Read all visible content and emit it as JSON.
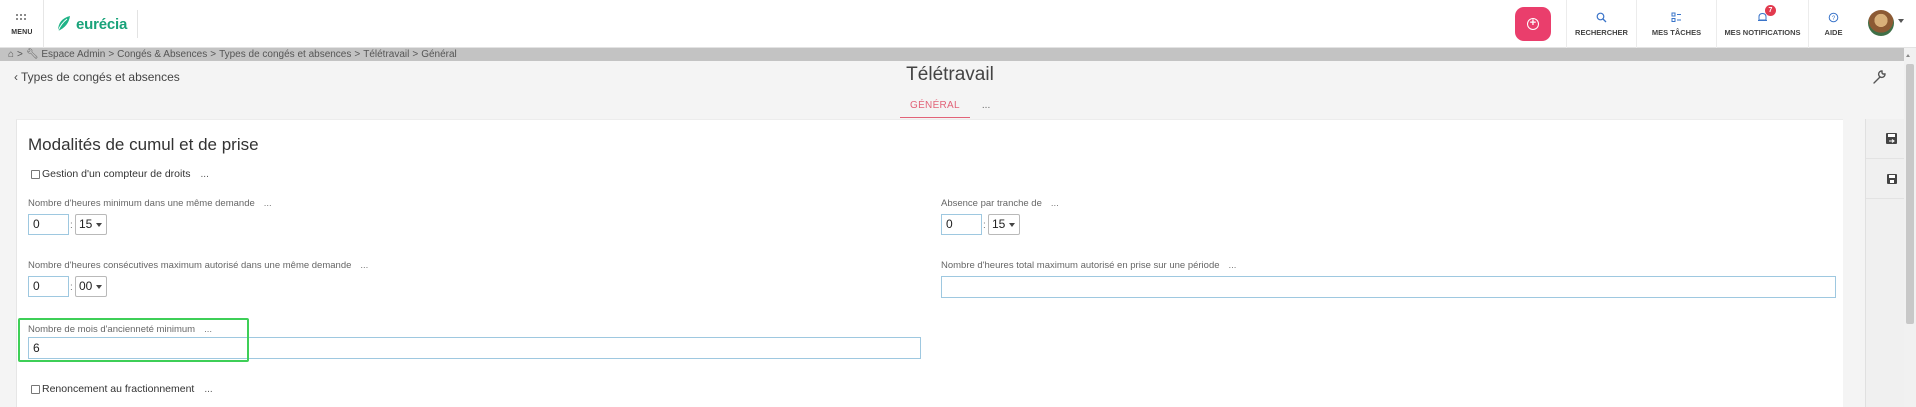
{
  "topbar": {
    "menu_label": "MENU",
    "logo_text": "eurécia",
    "items": [
      {
        "label": "RECHERCHER",
        "icon": "search-icon"
      },
      {
        "label": "MES TÂCHES",
        "icon": "tasks-icon"
      },
      {
        "label": "MES NOTIFICATIONS",
        "icon": "bell-icon",
        "badge": "7"
      },
      {
        "label": "AIDE",
        "icon": "help-icon"
      }
    ],
    "accent_color": "#ea3e6c",
    "brand_color": "#19a37a"
  },
  "breadcrumb": {
    "items": [
      "Espace Admin",
      "Congés & Absences",
      "Types de congés et absences",
      "Télétravail",
      "Général"
    ]
  },
  "page": {
    "back_label": "Types de congés et absences",
    "title": "Télétravail",
    "tabs": [
      "GÉNÉRAL"
    ],
    "tab_more": "..."
  },
  "form": {
    "section_title": "Modalités de cumul et de prise",
    "gestion_compteur": {
      "label": "Gestion d'un compteur de droits",
      "more": "...",
      "checked": false
    },
    "min_heures": {
      "label": "Nombre d'heures minimum dans une même demande",
      "more": "...",
      "hours": "0",
      "minutes": "15"
    },
    "absence_tranche": {
      "label": "Absence par tranche de",
      "more": "...",
      "hours": "0",
      "minutes": "15"
    },
    "max_consecutives": {
      "label": "Nombre d'heures consécutives maximum autorisé dans une même demande",
      "more": "...",
      "hours": "0",
      "minutes": "00"
    },
    "max_total_periode": {
      "label": "Nombre d'heures total maximum autorisé en prise sur une période",
      "more": "...",
      "value": ""
    },
    "anciennete": {
      "label": "Nombre de mois d'ancienneté minimum",
      "more": "...",
      "value": "6"
    },
    "renoncement": {
      "label": "Renoncement au fractionnement",
      "more": "...",
      "checked": false
    },
    "colon": ":"
  }
}
